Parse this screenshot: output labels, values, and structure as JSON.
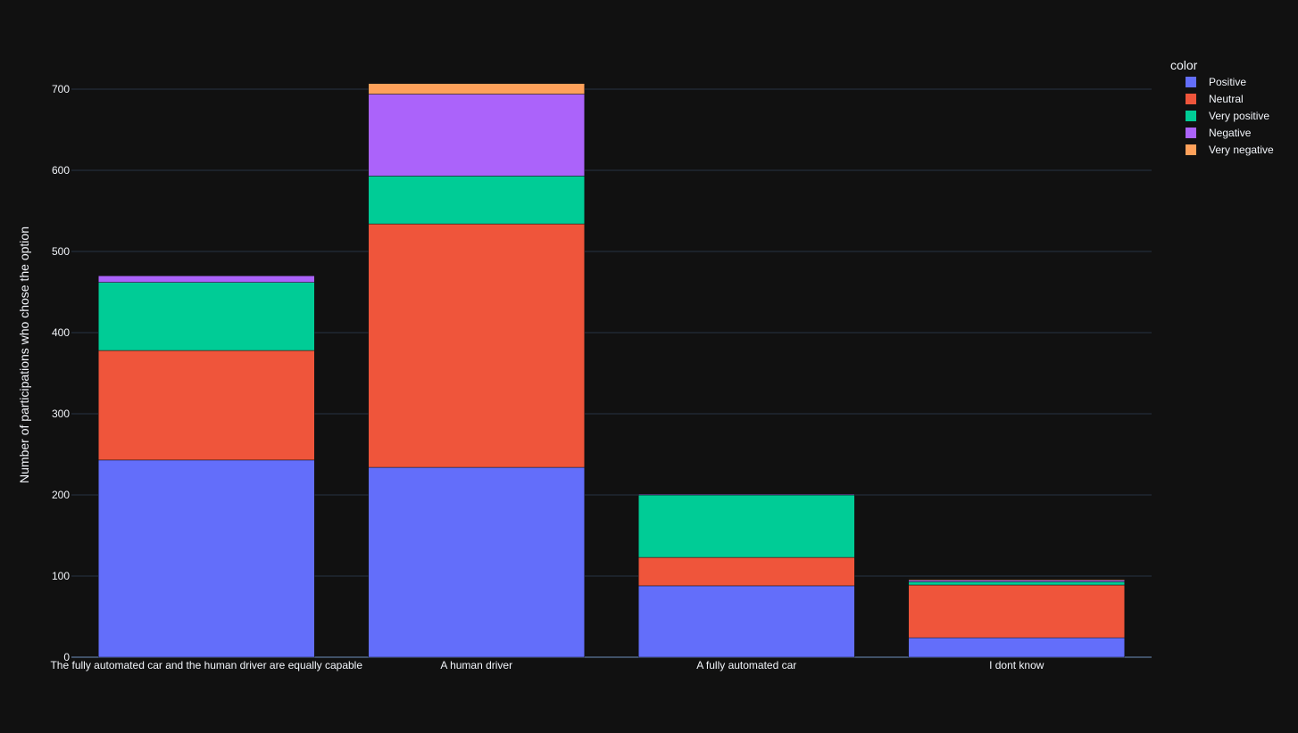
{
  "chart_data": {
    "type": "bar",
    "barmode": "stack",
    "title": "",
    "xlabel": "",
    "ylabel": "Number of participations who chose the option",
    "ylim": [
      0,
      744
    ],
    "yticks": [
      0,
      100,
      200,
      300,
      400,
      500,
      600,
      700
    ],
    "grid": true,
    "legend_title": "color",
    "legend_position": "top-right",
    "categories": [
      "The fully automated car and the human driver are equally capable",
      "A human driver",
      "A fully automated car",
      "I dont know"
    ],
    "series": [
      {
        "name": "Positive",
        "color": "#636efa",
        "values": [
          243,
          234,
          88,
          24
        ]
      },
      {
        "name": "Neutral",
        "color": "#ef553b",
        "values": [
          135,
          300,
          35,
          65
        ]
      },
      {
        "name": "Very positive",
        "color": "#00cc96",
        "values": [
          84,
          59,
          77,
          4
        ]
      },
      {
        "name": "Negative",
        "color": "#ab63fa",
        "values": [
          8,
          101,
          1,
          2
        ]
      },
      {
        "name": "Very negative",
        "color": "#ffa15a",
        "values": [
          0,
          13,
          0,
          1
        ]
      }
    ]
  }
}
